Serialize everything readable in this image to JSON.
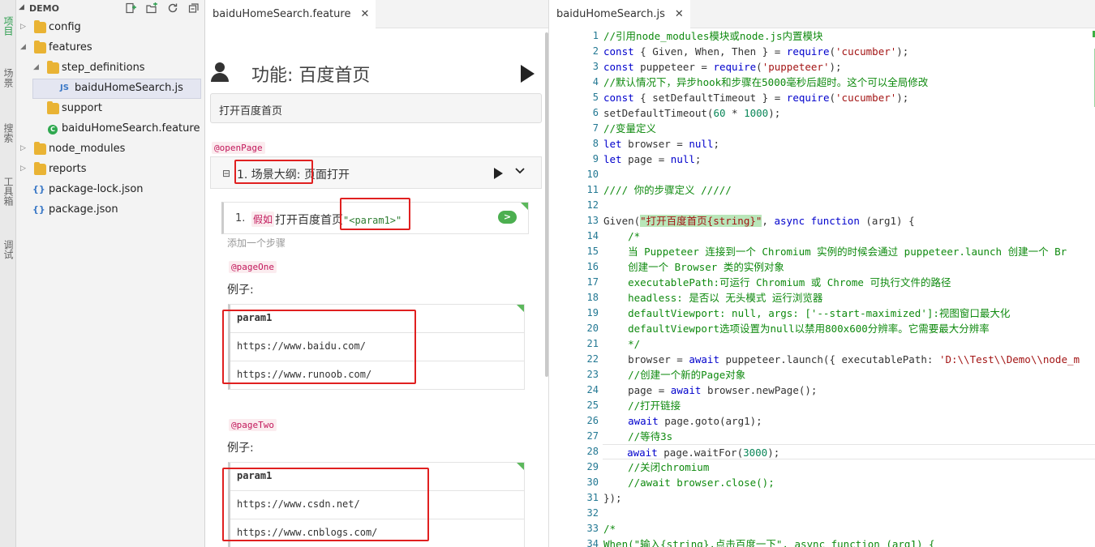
{
  "rail": {
    "items": [
      "项目",
      "场景",
      "搜索",
      "工具箱",
      "调试"
    ]
  },
  "explorer": {
    "title": "DEMO",
    "tree": [
      {
        "label": "config",
        "type": "folder",
        "depth": 0
      },
      {
        "label": "features",
        "type": "folder",
        "depth": 0
      },
      {
        "label": "step_definitions",
        "type": "folder",
        "depth": 1
      },
      {
        "label": "baiduHomeSearch.js",
        "type": "js",
        "depth": 2
      },
      {
        "label": "support",
        "type": "folder",
        "depth": 1
      },
      {
        "label": "baiduHomeSearch.feature",
        "type": "feature",
        "depth": 1
      },
      {
        "label": "node_modules",
        "type": "folder",
        "depth": 0
      },
      {
        "label": "reports",
        "type": "folder",
        "depth": 0
      },
      {
        "label": "package-lock.json",
        "type": "json",
        "depth": 0
      },
      {
        "label": "package.json",
        "type": "json",
        "depth": 0
      }
    ]
  },
  "feature_editor": {
    "tab": "baiduHomeSearch.feature",
    "title": "功能: 百度首页",
    "description": "打开百度首页",
    "scenario_tag": "@openPage",
    "scenario_label": "1. 场景大纲: 页面打开",
    "step_num": "1.",
    "step_keyword": "假如",
    "step_text": "打开百度首页",
    "step_param": "\"<param1>\"",
    "step_go": ">",
    "add_step": "添加一个步骤",
    "example_groups": [
      {
        "tag": "@pageOne",
        "label": "例子:",
        "header": "param1",
        "rows": [
          "https://www.baidu.com/",
          "https://www.runoob.com/"
        ]
      },
      {
        "tag": "@pageTwo",
        "label": "例子:",
        "header": "param1",
        "rows": [
          "https://www.csdn.net/",
          "https://www.cnblogs.com/"
        ]
      }
    ]
  },
  "code_editor": {
    "tab": "baiduHomeSearch.js",
    "first_line": 1,
    "current_line": 28,
    "lines": [
      "//引用node_modules模块或node.js内置模块",
      "const { Given, When, Then } = require('cucumber');",
      "const puppeteer = require('puppeteer');",
      "//默认情况下，异步hook和步骤在5000毫秒后超时。这个可以全局修改",
      "const { setDefaultTimeout } = require('cucumber');",
      "setDefaultTimeout(60 * 1000);",
      "//变量定义",
      "let browser = null;",
      "let page = null;",
      "",
      "//// 你的步骤定义 /////",
      "",
      "Given(\"打开百度首页{string}\", async function (arg1) {",
      "    /*",
      "    当 Puppeteer 连接到一个 Chromium 实例的时候会通过 puppeteer.launch 创建一个 Br",
      "    创建一个 Browser 类的实例对象",
      "    executablePath:可运行 Chromium 或 Chrome 可执行文件的路径",
      "    headless: 是否以 无头模式 运行浏览器",
      "    defaultViewport: null, args: ['--start-maximized']:视图窗口最大化",
      "    defaultViewport选项设置为null以禁用800x600分辨率。它需要最大分辨率",
      "    */",
      "    browser = await puppeteer.launch({ executablePath: 'D:\\\\Test\\\\Demo\\\\node_m",
      "    //创建一个新的Page对象",
      "    page = await browser.newPage();",
      "    //打开链接",
      "    await page.goto(arg1);",
      "    //等待3s",
      "    await page.waitFor(3000);",
      "    //关闭chromium",
      "    //await browser.close();",
      "});",
      "",
      "/*",
      "When(\"输入{string},点击百度一下\", async function (arg1) {"
    ]
  },
  "colors": {
    "comment": "#0f8a0f",
    "keyword": "#0000cc",
    "string": "#a31515",
    "number": "#098658",
    "highlight_box": "#e02020",
    "tag": "#c2185b",
    "line_number": "#237893"
  }
}
